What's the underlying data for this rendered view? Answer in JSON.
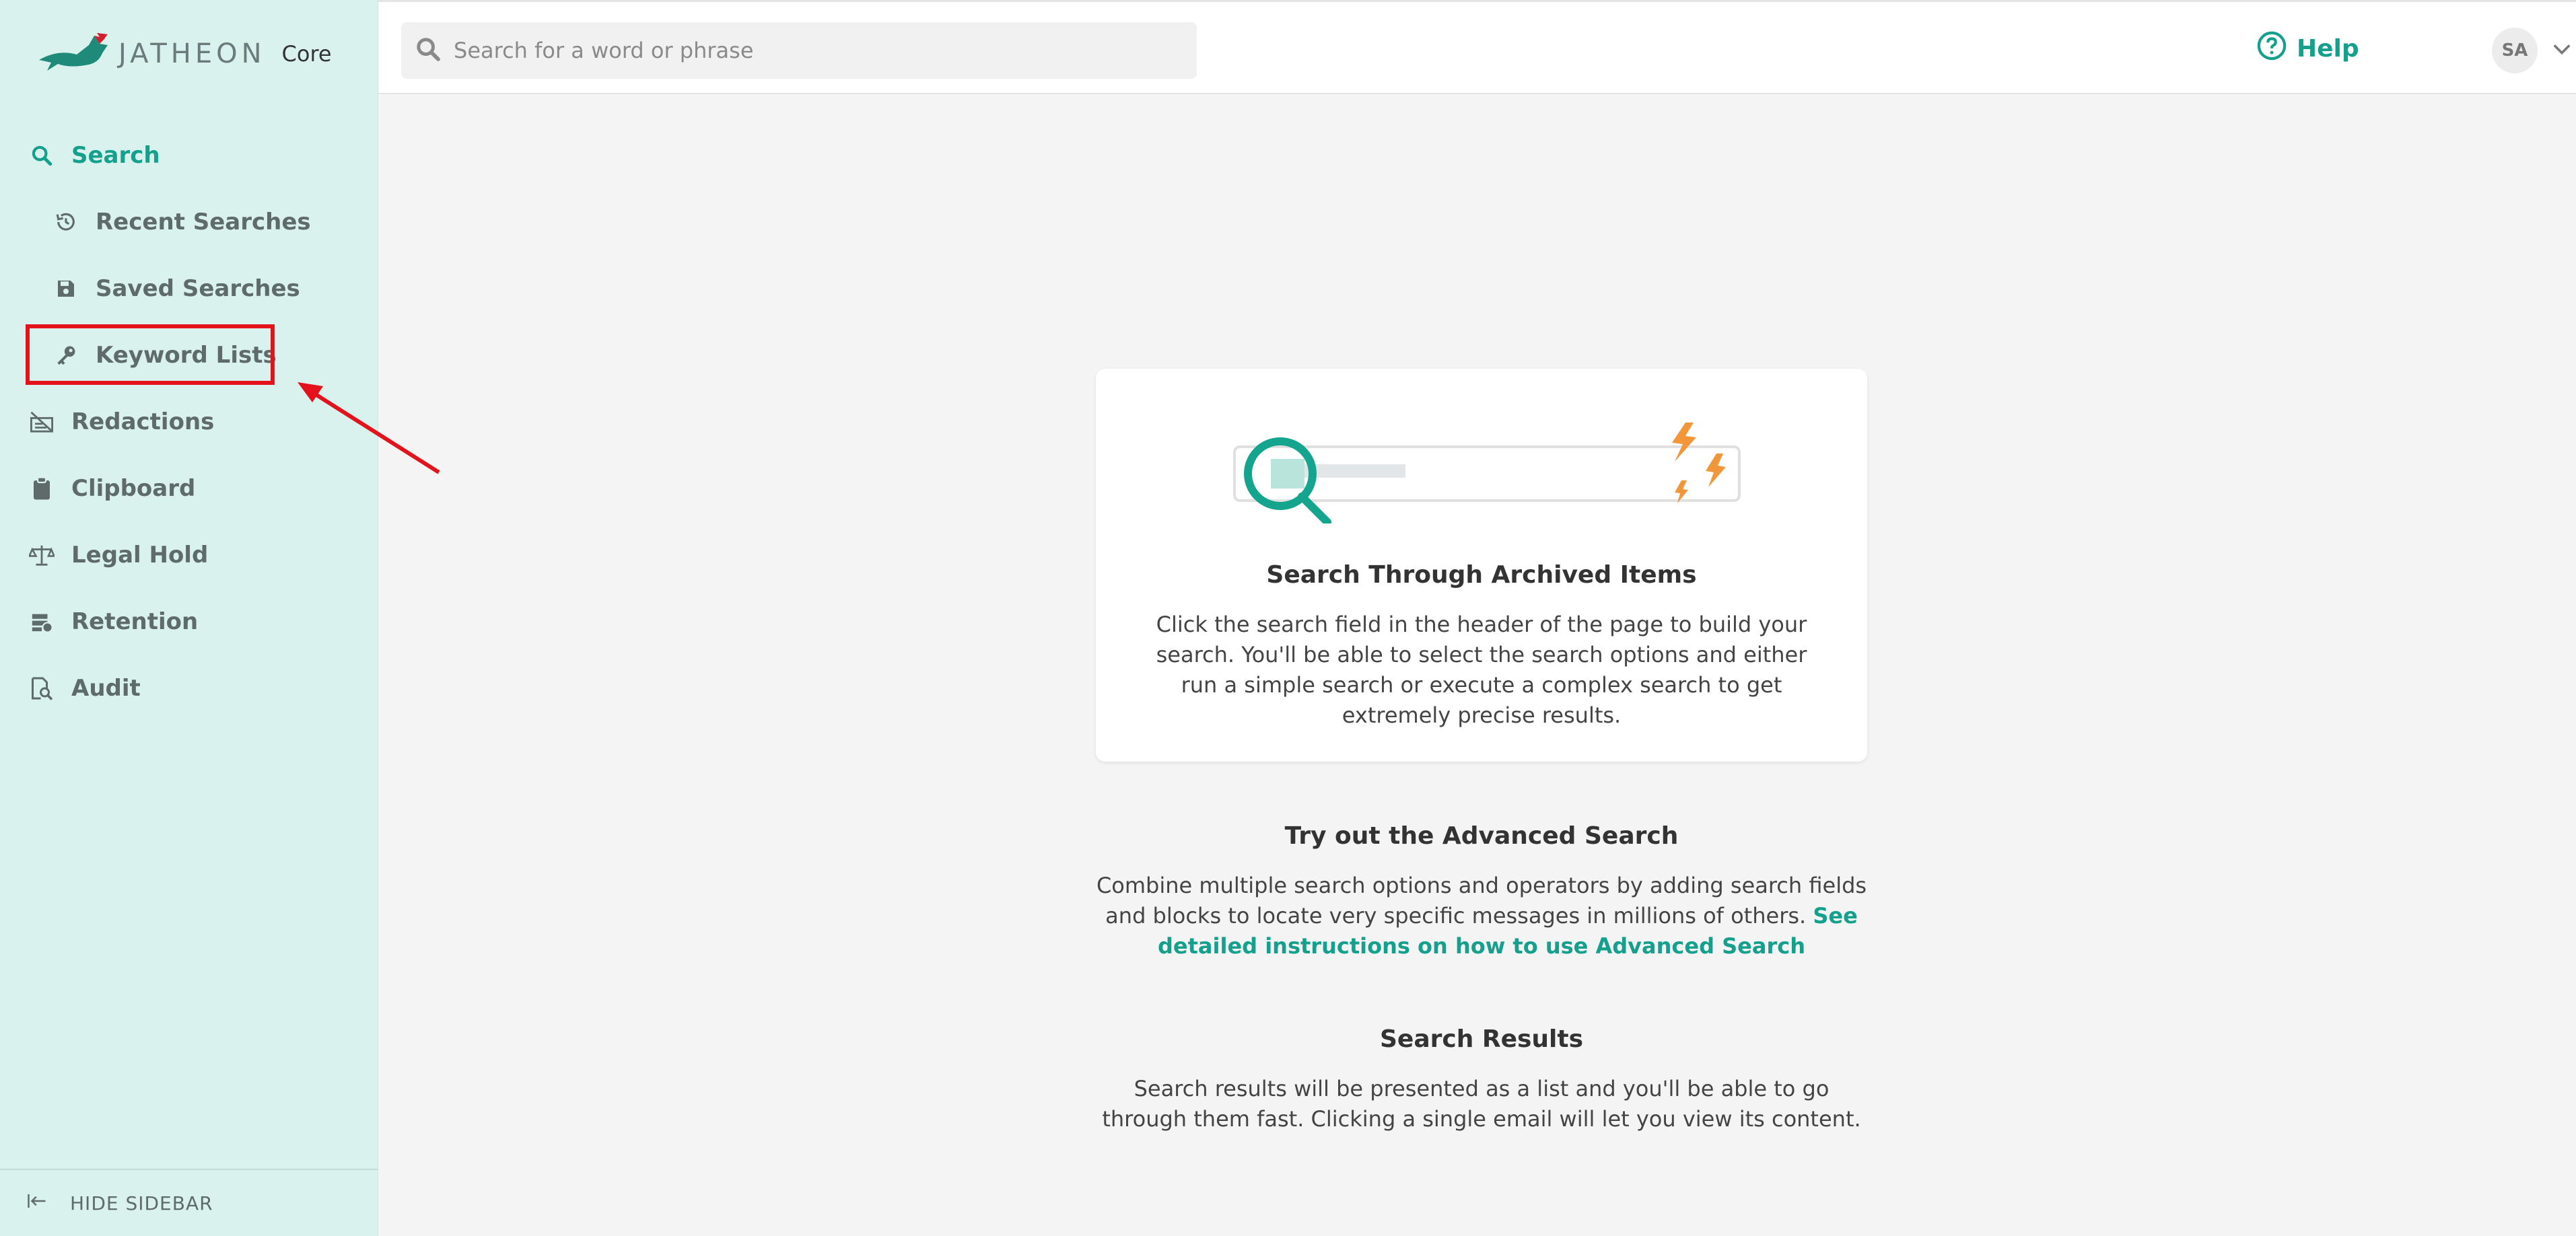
{
  "app": {
    "logo_text": "JATHEON",
    "logo_suffix": "Core"
  },
  "header": {
    "search_placeholder": "Search for a word or phrase",
    "help_label": "Help",
    "avatar_initials": "SA"
  },
  "sidebar": {
    "items": [
      {
        "label": "Search",
        "icon": "search-icon",
        "level": "top",
        "active": true
      },
      {
        "label": "Recent Searches",
        "icon": "history-icon",
        "level": "sub"
      },
      {
        "label": "Saved Searches",
        "icon": "floppy-icon",
        "level": "sub"
      },
      {
        "label": "Keyword Lists",
        "icon": "key-icon",
        "level": "sub",
        "highlighted": true
      },
      {
        "label": "Redactions",
        "icon": "redaction-icon",
        "level": "top"
      },
      {
        "label": "Clipboard",
        "icon": "clipboard-icon",
        "level": "top"
      },
      {
        "label": "Legal Hold",
        "icon": "scales-icon",
        "level": "top"
      },
      {
        "label": "Retention",
        "icon": "retention-icon",
        "level": "top"
      },
      {
        "label": "Audit",
        "icon": "audit-icon",
        "level": "top"
      }
    ],
    "hide_label": "HIDE SIDEBAR"
  },
  "main": {
    "card_title": "Search Through Archived Items",
    "card_body": "Click the search field in the header of the page to build your search. You'll be able to select the search options and either run a simple search or execute a complex search to get extremely precise results.",
    "advanced_title": "Try out the Advanced Search",
    "advanced_body": "Combine multiple search options and operators by adding search fields and blocks to locate very specific messages in millions of others.",
    "advanced_link": "See detailed instructions on how to use Advanced Search",
    "results_title": "Search Results",
    "results_body": "Search results will be presented as a list and you'll be able to go through them fast. Clicking a single email will let you view its content."
  },
  "colors": {
    "accent": "#14a08d",
    "sidebar_bg": "#d9f2ee",
    "highlight": "#e3121b",
    "lightning": "#f2963a"
  }
}
